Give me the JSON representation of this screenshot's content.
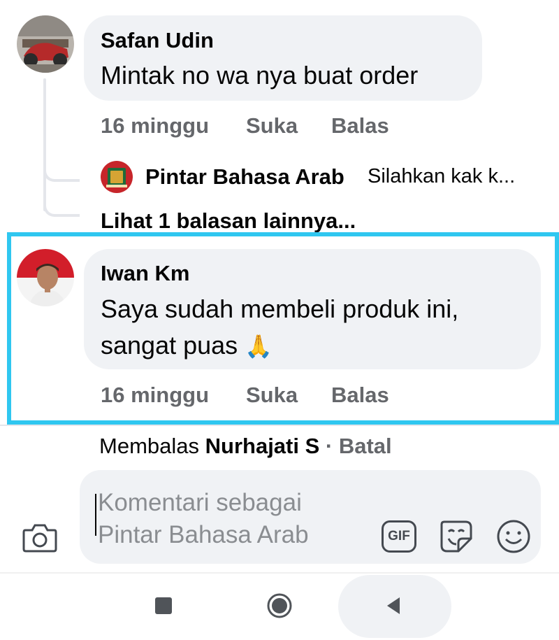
{
  "comment1": {
    "author": "Safan Udin",
    "text": "Mintak no wa nya buat order",
    "time": "16 minggu",
    "like_label": "Suka",
    "reply_label": "Balas"
  },
  "reply_preview": {
    "author": "Pintar Bahasa Arab",
    "text": "Silahkan kak k..."
  },
  "more_replies_label": "Lihat 1 balasan lainnya...",
  "comment2": {
    "author": "Iwan Km",
    "text_line1": "Saya sudah membeli produk ini,",
    "text_line2": "sangat puas",
    "emoji": "🙏",
    "time": "16 minggu",
    "like_label": "Suka",
    "reply_label": "Balas"
  },
  "reply_context": {
    "prefix": "Membalas",
    "name": "Nurhajati S",
    "separator": "·",
    "cancel_label": "Batal"
  },
  "composer": {
    "placeholder_line1": "Komentari sebagai",
    "placeholder_line2": "Pintar Bahasa Arab",
    "gif_label": "GIF"
  },
  "colors": {
    "highlight": "#2fc7f0",
    "bubble": "#f0f2f5",
    "meta_text": "#65676b"
  }
}
